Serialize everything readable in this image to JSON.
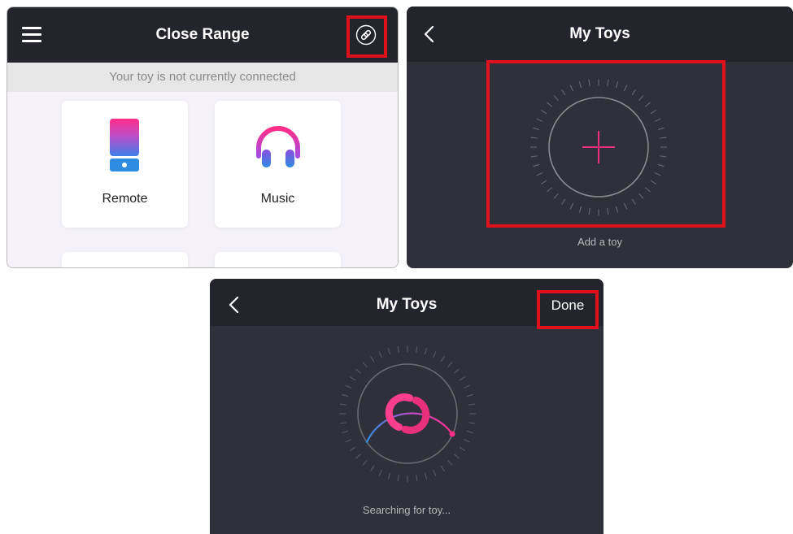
{
  "panel_close_range": {
    "title": "Close Range",
    "banner": "Your toy is not currently connected",
    "cards": [
      {
        "label": "Remote",
        "icon": "remote-icon"
      },
      {
        "label": "Music",
        "icon": "headphones-icon"
      }
    ],
    "icons": {
      "menu": "menu-icon",
      "link": "link-icon"
    }
  },
  "panel_my_toys_add": {
    "title": "My Toys",
    "add_caption": "Add a toy",
    "icons": {
      "back": "chevron-left-icon",
      "add": "plus-icon"
    }
  },
  "panel_my_toys_search": {
    "title": "My Toys",
    "done_label": "Done",
    "search_caption": "Searching for toy...",
    "icons": {
      "back": "chevron-left-icon",
      "spinner": "loading-spinner-icon"
    }
  },
  "colors": {
    "accent_pink": "#e8317a",
    "accent_blue": "#2e8de0",
    "highlight_red": "#e0101c",
    "dark_header": "#24252c",
    "dark_body": "#2f3039"
  }
}
